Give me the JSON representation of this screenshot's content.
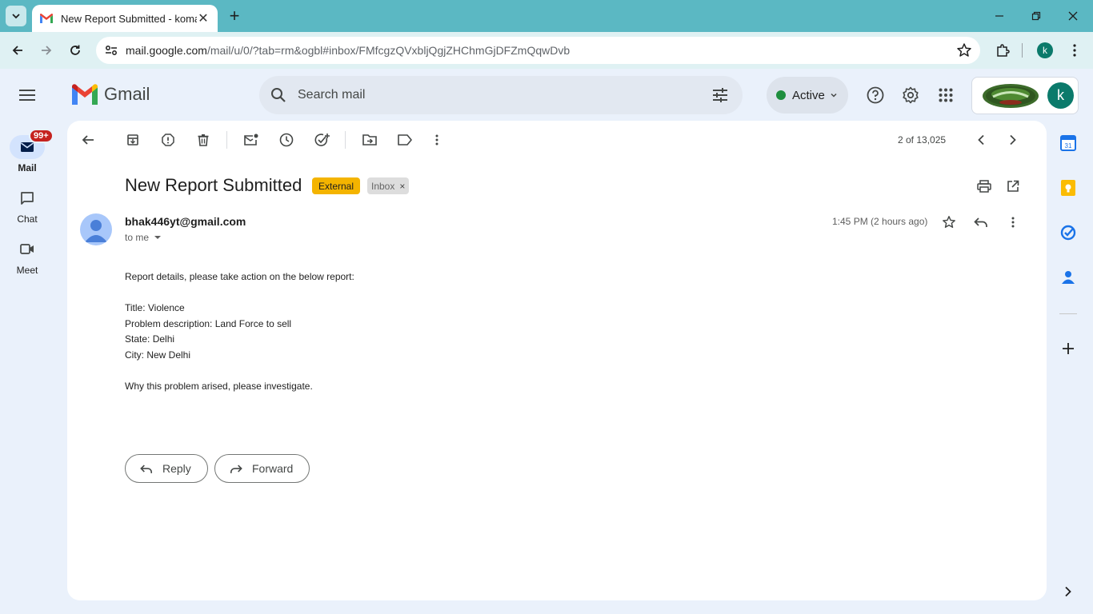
{
  "browser": {
    "tab_title": "New Report Submitted - komal",
    "url_host": "mail.google.com",
    "url_path": "/mail/u/0/?tab=rm&ogbl#inbox/FMfcgzQVxbljQgjZHChmGjDFZmQqwDvb",
    "profile_initial": "k"
  },
  "gmail": {
    "logo_text": "Gmail",
    "search_placeholder": "Search mail",
    "status_label": "Active",
    "account_initial": "k"
  },
  "rail": {
    "mail_label": "Mail",
    "mail_badge": "99+",
    "chat_label": "Chat",
    "meet_label": "Meet"
  },
  "toolbar": {
    "pager": "2 of 13,025"
  },
  "email": {
    "subject": "New Report Submitted",
    "labels": [
      "External",
      "Inbox"
    ],
    "sender": "bhak446yt@gmail.com",
    "to": "to me",
    "time": "1:45 PM (2 hours ago)",
    "body": [
      "Report details, please take action on the below report:",
      "",
      "Title: Violence",
      "Problem description: Land Force to sell",
      "State: Delhi",
      "City: New Delhi",
      "",
      "Why this problem arised, please investigate."
    ],
    "reply_label": "Reply",
    "forward_label": "Forward"
  },
  "colors": {
    "tabbar": "#5bb8c3",
    "toolbar": "#dff1f3",
    "gmail_bg": "#eaf1fb",
    "external_label": "#f4b400",
    "avatar": "#0b7a6b"
  }
}
